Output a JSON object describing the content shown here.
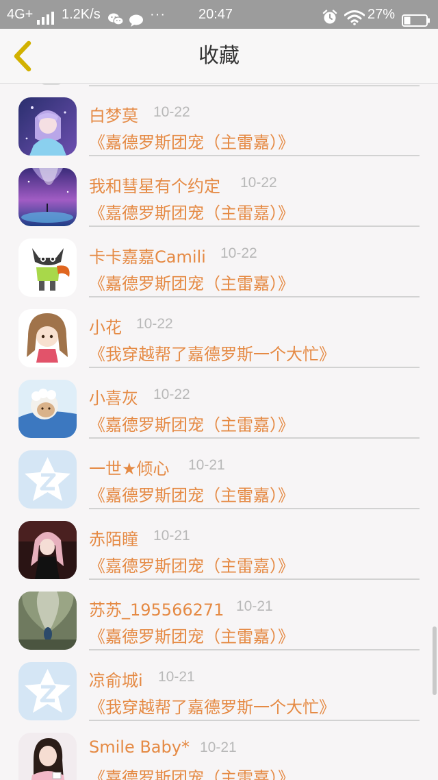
{
  "status_bar": {
    "network": "4G+",
    "speed": "1.2K/s",
    "more": "···",
    "time": "20:47",
    "battery_percent": "27%",
    "icons": [
      "signal-icon",
      "wechat-icon",
      "chat-bubble-icon",
      "alarm-icon",
      "wifi-icon",
      "battery-icon"
    ]
  },
  "header": {
    "title": "收藏",
    "back_icon": "chevron-left-icon"
  },
  "colors": {
    "accent": "#e58a44",
    "date": "#b8b8b8",
    "status_bar_bg": "#9c9c9c",
    "back_icon": "#d2b100"
  },
  "favorites": [
    {
      "name": "白梦莫",
      "date": "10-22",
      "book": "《嘉德罗斯团宠（主雷嘉）》",
      "avatar": "anime-girl-avatar"
    },
    {
      "name": "我和彗星有个约定",
      "date": "10-22",
      "book": "《嘉德罗斯团宠（主雷嘉）》",
      "avatar": "galaxy-avatar"
    },
    {
      "name": "卡卡嘉嘉Camili",
      "date": "10-22",
      "book": "《嘉德罗斯团宠（主雷嘉）》",
      "avatar": "cartoon-fox-avatar"
    },
    {
      "name": "小花",
      "date": "10-22",
      "book": "《我穿越帮了嘉德罗斯一个大忙》",
      "avatar": "chibi-girl-avatar"
    },
    {
      "name": "小喜灰",
      "date": "10-22",
      "book": "《嘉德罗斯团宠（主雷嘉）》",
      "avatar": "sheep-avatar"
    },
    {
      "name": "一世★倾心",
      "date": "10-21",
      "book": "《嘉德罗斯团宠（主雷嘉）》",
      "avatar": "default-qzone-avatar"
    },
    {
      "name": "赤陌瞳",
      "date": "10-21",
      "book": "《嘉德罗斯团宠（主雷嘉）》",
      "avatar": "dark-girl-avatar"
    },
    {
      "name": "苏苏_195566271",
      "date": "10-21",
      "book": "《嘉德罗斯团宠（主雷嘉）》",
      "avatar": "peacock-avatar"
    },
    {
      "name": "凉俞城i",
      "date": "10-21",
      "book": "《我穿越帮了嘉德罗斯一个大忙》",
      "avatar": "default-qzone-avatar"
    },
    {
      "name": "Smile Baby*",
      "date": "10-21",
      "book": "《嘉德罗斯团宠（主雷嘉）》",
      "avatar": "photo-girl-avatar"
    }
  ]
}
